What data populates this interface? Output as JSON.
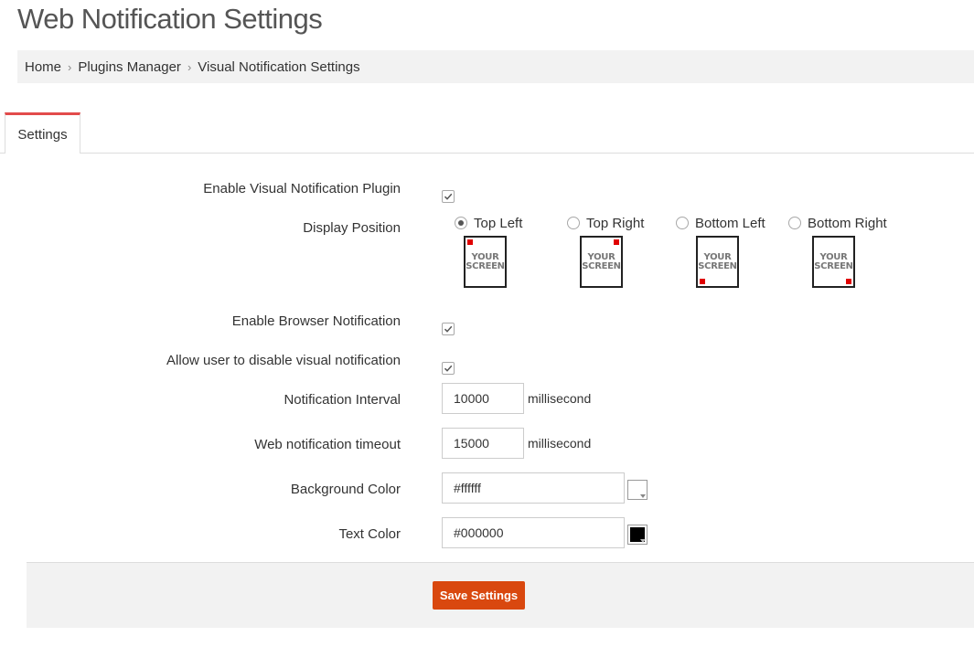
{
  "page": {
    "title": "Web Notification Settings"
  },
  "breadcrumb": {
    "items": [
      "Home",
      "Plugins Manager",
      "Visual Notification Settings"
    ]
  },
  "tabs": [
    {
      "label": "Settings",
      "active": true
    }
  ],
  "form": {
    "enable_plugin": {
      "label": "Enable Visual Notification Plugin",
      "checked": true
    },
    "display_position": {
      "label": "Display Position",
      "options": [
        {
          "label": "Top Left",
          "checked": true,
          "corner": "top-left"
        },
        {
          "label": "Top Right",
          "checked": false,
          "corner": "top-right"
        },
        {
          "label": "Bottom Left",
          "checked": false,
          "corner": "bottom-left"
        },
        {
          "label": "Bottom Right",
          "checked": false,
          "corner": "bottom-right"
        }
      ],
      "screen_text_line1": "YOUR",
      "screen_text_line2": "SCREEN"
    },
    "enable_browser": {
      "label": "Enable Browser Notification",
      "checked": true
    },
    "allow_disable": {
      "label": "Allow user to disable visual notification",
      "checked": true
    },
    "interval": {
      "label": "Notification Interval",
      "value": "10000",
      "unit": "millisecond"
    },
    "timeout": {
      "label": "Web notification timeout",
      "value": "15000",
      "unit": "millisecond"
    },
    "bg_color": {
      "label": "Background Color",
      "value": "#ffffff",
      "swatch": "#ffffff"
    },
    "text_color": {
      "label": "Text Color",
      "value": "#000000",
      "swatch": "#000000"
    }
  },
  "footer": {
    "save_label": "Save Settings"
  },
  "colors": {
    "accent": "#d9480f",
    "tab_border": "#e24b4b",
    "marker": "#e00000"
  }
}
